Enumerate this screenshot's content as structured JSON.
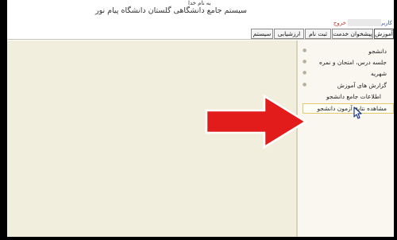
{
  "header": {
    "small_text": "به نام خدا",
    "title": "سیستم جامع دانشگاهی گلستان   دانشگاه پیام نور",
    "user_label": "کاربر",
    "logout": "خروج"
  },
  "tabs": [
    "آموزش",
    "پیشخوان خدمت",
    "ثبت نام",
    "ارزشیابی",
    "سیستم"
  ],
  "menu": {
    "items": [
      "دانشجو",
      "جلسه درس، امتحان و نمره",
      "شهریه",
      "گزارش های آموزش",
      "اطلاعات جامع دانشجو"
    ],
    "selected_item": "مشاهده نتایج آزمون دانشجو"
  },
  "colors": {
    "arrow": "#e21b1b",
    "arrow_border": "#ffffff",
    "content_bg": "#f2eedd",
    "selected_border": "#e4c86b"
  },
  "icons": {
    "arrow": "big-red-arrow-icon",
    "cursor": "mouse-pointer-icon",
    "bullet": "bullet-icon"
  }
}
